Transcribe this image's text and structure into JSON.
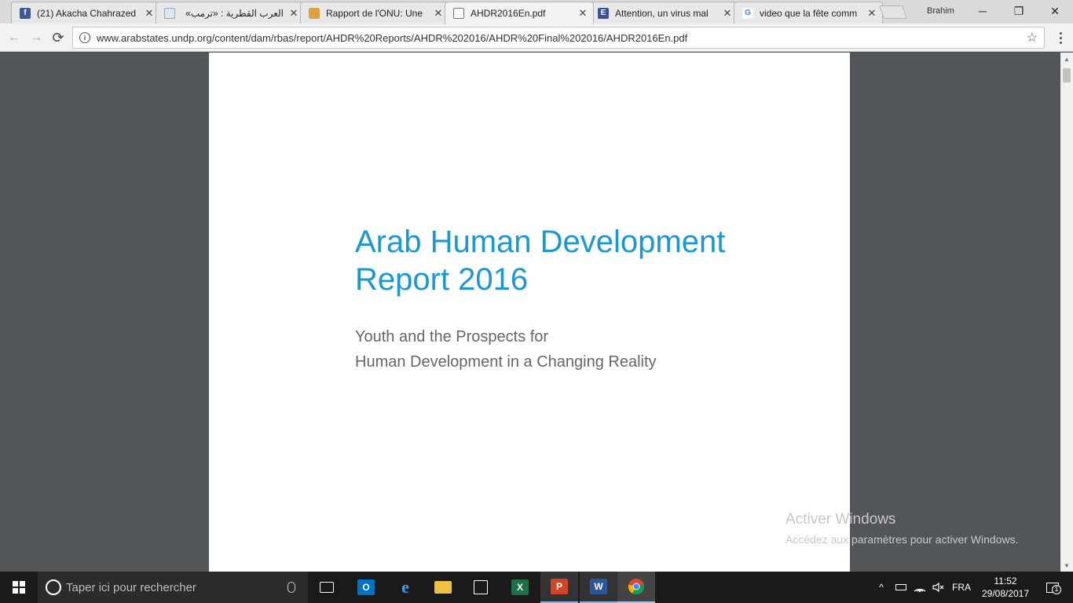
{
  "browser": {
    "tabs": [
      {
        "title": "(21) Akacha Chahrazed",
        "icon": "facebook-icon",
        "color": "#3b5998",
        "glyph": "f"
      },
      {
        "title": "العرب القطرية : «ترمب»",
        "icon": "page-icon",
        "color": "#8fa7c5",
        "glyph": ""
      },
      {
        "title": "Rapport de l'ONU: Une",
        "icon": "site-icon",
        "color": "#e0a040",
        "glyph": ""
      },
      {
        "title": "AHDR2016En.pdf",
        "icon": "document-icon",
        "color": "#ffffff",
        "glyph": ""
      },
      {
        "title": "Attention, un virus mal",
        "icon": "e-site-icon",
        "color": "#3c4fa0",
        "glyph": "E"
      },
      {
        "title": "video que la fête comm",
        "icon": "google-icon",
        "color": "#ffffff",
        "glyph": "G"
      }
    ],
    "active_tab": 3,
    "profile_name": "Brahim",
    "window_controls": {
      "minimize": "─",
      "restore": "❐",
      "close": "✕"
    },
    "url": "www.arabstates.undp.org/content/dam/rbas/report/AHDR%20Reports/AHDR%202016/AHDR%20Final%202016/AHDR2016En.pdf",
    "nav": {
      "back": "←",
      "forward": "→",
      "reload": "⟳"
    },
    "star": "☆"
  },
  "document": {
    "title_line1": "Arab Human Development",
    "title_line2": "Report 2016",
    "subtitle_line1": "Youth and the Prospects for",
    "subtitle_line2": "Human Development in a Changing Reality",
    "title_color": "#1a98d5"
  },
  "watermark": {
    "line1": "Activer Windows",
    "line2": "Accédez aux paramètres pour activer Windows."
  },
  "taskbar": {
    "search_placeholder": "Taper ici pour rechercher",
    "apps": [
      {
        "name": "task-view-icon",
        "label": "▭",
        "color": "transparent"
      },
      {
        "name": "outlook-icon",
        "label": "O",
        "color": "#0072c6"
      },
      {
        "name": "edge-icon",
        "label": "e",
        "color": "transparent"
      },
      {
        "name": "file-explorer-icon",
        "label": "",
        "color": "#f0c040"
      },
      {
        "name": "store-icon",
        "label": "🛍",
        "color": "transparent"
      },
      {
        "name": "excel-icon",
        "label": "X",
        "color": "#1e7145"
      },
      {
        "name": "powerpoint-icon",
        "label": "P",
        "color": "#d04525"
      },
      {
        "name": "word-icon",
        "label": "W",
        "color": "#2b579a"
      },
      {
        "name": "chrome-icon",
        "label": "",
        "color": "transparent"
      }
    ],
    "tray": {
      "chevron": "^",
      "language": "FRA",
      "time": "11:52",
      "date": "29/08/2017",
      "notification_count": "1"
    }
  }
}
